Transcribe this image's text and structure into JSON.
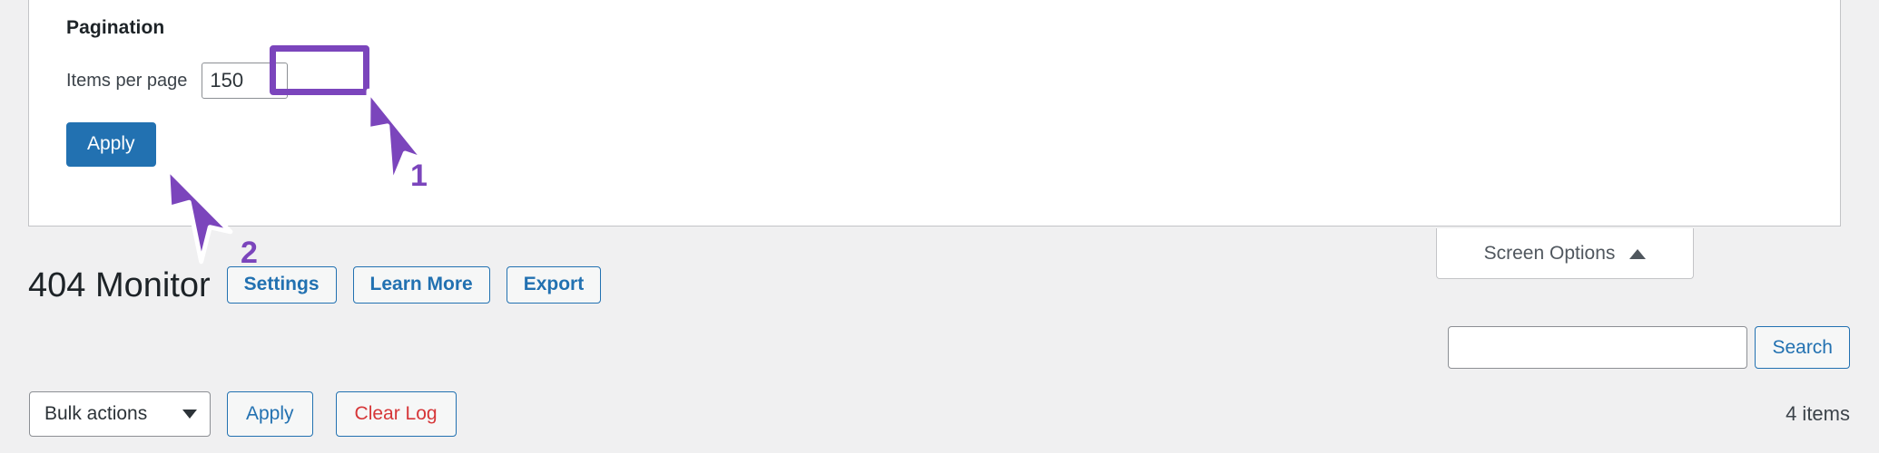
{
  "screen_options_panel": {
    "heading": "Pagination",
    "items_per_page_label": "Items per page",
    "items_per_page_value": "150",
    "apply_label": "Apply"
  },
  "screen_options_tab": {
    "label": "Screen Options",
    "caret": "caret-up"
  },
  "header": {
    "page_title": "404 Monitor",
    "buttons": [
      {
        "label": "Settings"
      },
      {
        "label": "Learn More"
      },
      {
        "label": "Export"
      }
    ]
  },
  "search": {
    "value": "",
    "placeholder": "",
    "button_label": "Search"
  },
  "bulk": {
    "select_value": "Bulk actions",
    "apply_label": "Apply",
    "clear_log_label": "Clear Log",
    "items_count": "4 items"
  },
  "annotations": [
    {
      "number": "1"
    },
    {
      "number": "2"
    }
  ],
  "colors": {
    "accent_blue": "#2271b1",
    "danger_red": "#d63638",
    "annotation_purple": "#7b45bc",
    "page_background": "#f0f0f1",
    "panel_background": "#ffffff"
  }
}
